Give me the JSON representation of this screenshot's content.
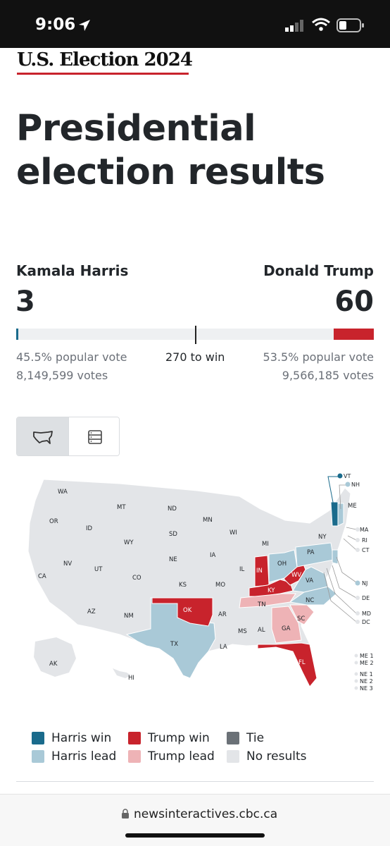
{
  "status_bar": {
    "time": "9:06"
  },
  "brand": "U.S. Election 2024",
  "title": "Presidential election results",
  "candidates": {
    "harris": {
      "name": "Kamala Harris",
      "electoral_votes": "3",
      "popular_pct": "45.5% popular vote",
      "votes": "8,149,599 votes",
      "ev_fraction": 0.0056
    },
    "trump": {
      "name": "Donald Trump",
      "electoral_votes": "60",
      "popular_pct": "53.5% popular vote",
      "votes": "9,566,185 votes",
      "ev_fraction": 0.1115
    }
  },
  "to_win": "270 to win",
  "view_toggle": {
    "map_icon": "us-map-icon",
    "table_icon": "table-icon",
    "selected": "map"
  },
  "map": {
    "state_labels": [
      "WA",
      "OR",
      "CA",
      "ID",
      "NV",
      "MT",
      "WY",
      "UT",
      "AZ",
      "CO",
      "NM",
      "ND",
      "SD",
      "NE",
      "KS",
      "OK",
      "TX",
      "MN",
      "IA",
      "MO",
      "AR",
      "LA",
      "WI",
      "IL",
      "MI",
      "IN",
      "OH",
      "KY",
      "TN",
      "MS",
      "AL",
      "GA",
      "FL",
      "SC",
      "NC",
      "VA",
      "WV",
      "PA",
      "NY",
      "ME",
      "AK",
      "HI"
    ],
    "small_states": [
      "VT",
      "NH",
      "MA",
      "RI",
      "CT",
      "NJ",
      "DE",
      "MD",
      "DC"
    ],
    "districts": [
      "ME 1",
      "ME 2",
      "NE 1",
      "NE 2",
      "NE 3"
    ],
    "colors": {
      "harris_win": "#1a6b8c",
      "harris_lead": "#a9c9d7",
      "trump_win": "#c8232c",
      "trump_lead": "#eeb3b6",
      "tie": "#6b7177",
      "no_results": "#e3e5e8"
    }
  },
  "legend": [
    {
      "label": "Harris win",
      "color": "#1a6b8c"
    },
    {
      "label": "Trump win",
      "color": "#c8232c"
    },
    {
      "label": "Tie",
      "color": "#6b7177"
    },
    {
      "label": "Harris lead",
      "color": "#a9c9d7"
    },
    {
      "label": "Trump lead",
      "color": "#eeb3b6"
    },
    {
      "label": "No results",
      "color": "#e3e5e8"
    }
  ],
  "browser": {
    "url": "newsinteractives.cbc.ca"
  }
}
